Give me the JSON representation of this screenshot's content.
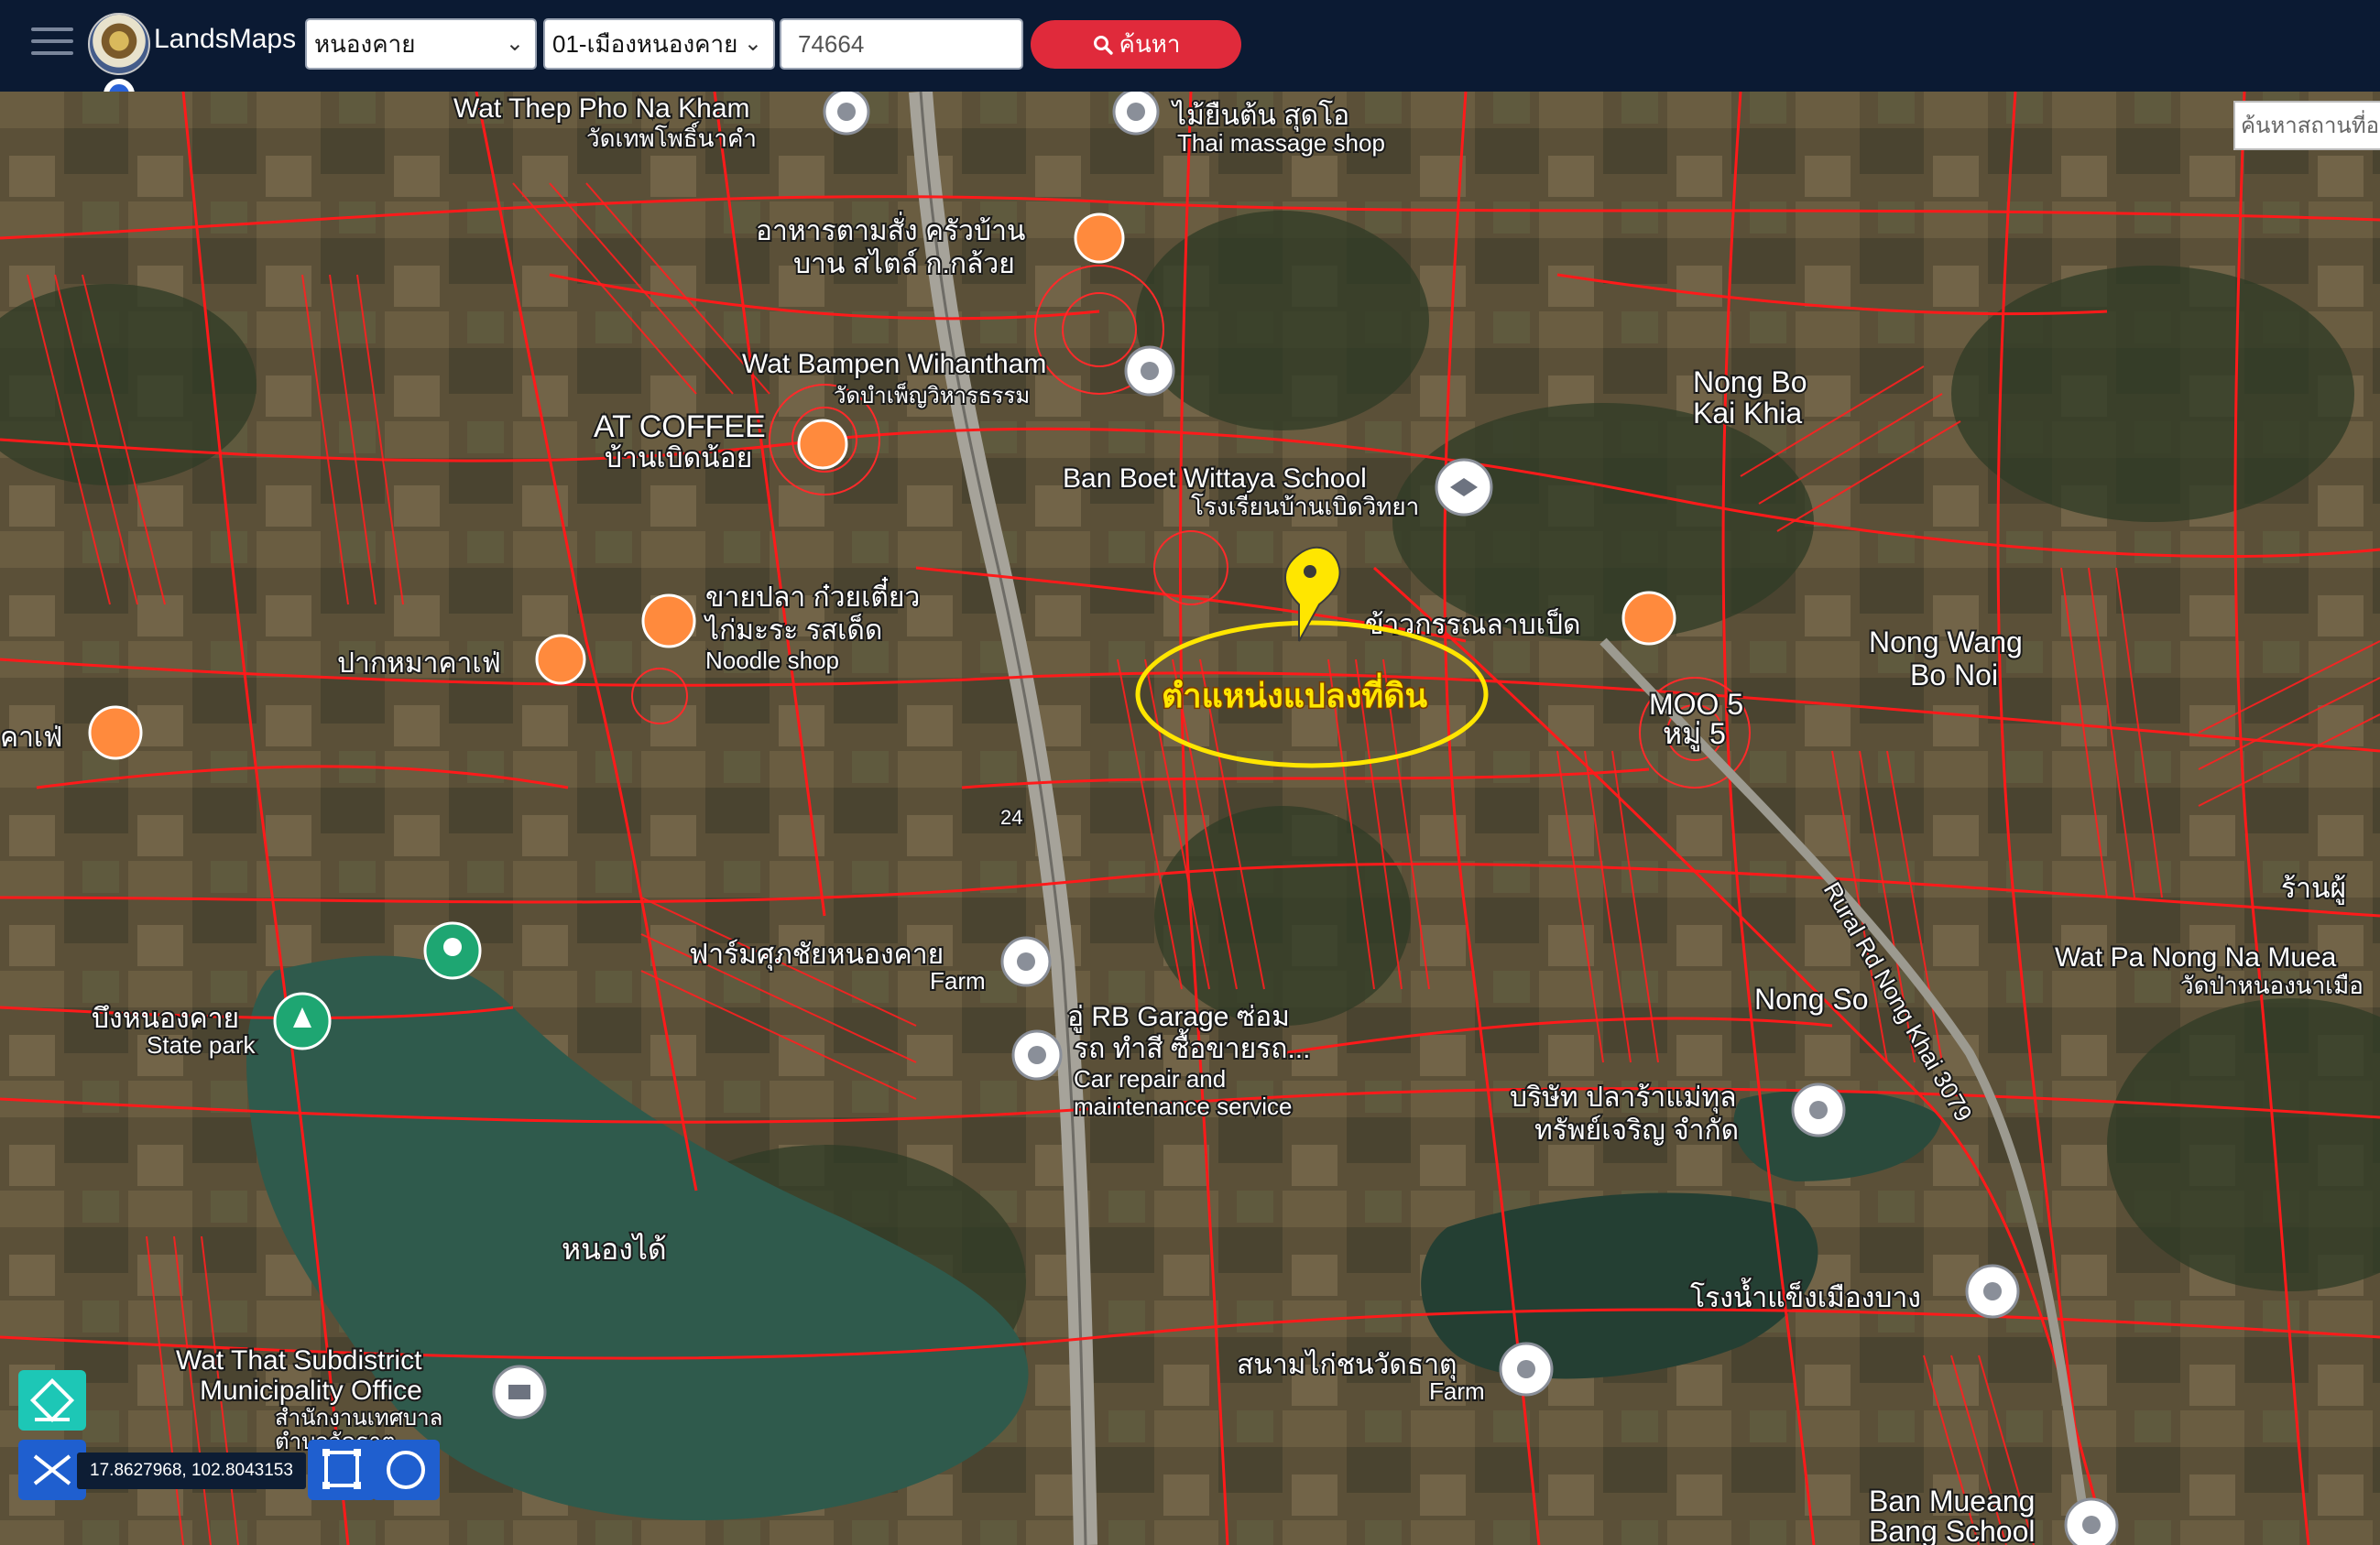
{
  "app": {
    "title": "LandsMaps"
  },
  "search": {
    "province": "หนองคาย",
    "district": "01-เมืองหนองคาย",
    "parcel_number": "74664",
    "button_label": "ค้นหา",
    "place_placeholder": "ค้นหาสถานที่อ"
  },
  "map": {
    "highlight_label": "ตำแหน่งแปลงที่ดิน",
    "labels": {
      "wat_thep": "Wat Thep Pho Na Kham",
      "wat_thep_th": "วัดเทพโพธิ์นาคำ",
      "mai_yuen": "ไม้ยืนต้น สุดโอ",
      "thai_massage": "Thai massage shop",
      "food_1": "อาหารตามสั่ง ครัวบ้าน",
      "food_2": "บาน สไตล์ ก.กล้วย",
      "wat_bampen": "Wat Bampen Wihantham",
      "wat_bampen_th": "วัดบำเพ็ญวิหารธรรม",
      "at_coffee": "AT COFFEE",
      "ban_boet": "บ้านเบิดน้อย",
      "school": "Ban Boet Wittaya School",
      "school_th": "โรงเรียนบ้านเบิดวิทยา",
      "nong_bo": "Nong Bo",
      "kai_khia": "Kai Khia",
      "noodle_th_1": "ขายปลา ก๋วยเตี๋ยว",
      "noodle_th_2": "ไก่มะระ รสเด็ด",
      "noodle_shop": "Noodle shop",
      "cafe_1": "ปากหมาคาเฟ่",
      "cafe_2": "คาเฟ่",
      "khaoduan": "ข้าวกรรณลาบเป็ด",
      "nong_wang": "Nong Wang",
      "bo_noi": "Bo Noi",
      "moo5": "MOO 5",
      "moo5_th": "หมู่ 5",
      "route": "24",
      "rural_rd": "Rural Rd Nong Khai 3079",
      "farm_th": "ฟาร์มศุภชัยหนองคาย",
      "farm": "Farm",
      "garage_1": "อู่ RB Garage ซ่อม",
      "garage_2": "รถ ทำสี ซื้อขายรถ...",
      "garage_3": "Car repair and",
      "garage_4": "maintenance service",
      "park_th": "บึงหนองคาย",
      "park": "State park",
      "nong_so": "Nong So",
      "company_1": "บริษัท ปลาร้าแม่ทุล",
      "company_2": "ทรัพย์เจริญ จำกัด",
      "wat_pa": "Wat Pa Nong Na Muea",
      "wat_pa_th": "วัดป่าหนองนาเมือ",
      "nong_dai": "หนองได้",
      "wat_that": "Wat That Subdistrict",
      "municipality": "Municipality Office",
      "municipality_th_1": "สำนักงานเทศบาล",
      "municipality_th_2": "ตำบลวัดธาตุ",
      "ice_factory": "โรงน้ำแข็งเมืองบาง",
      "cockfight": "สนามไก่ชนวัดธาตุ",
      "farm2": "Farm",
      "ban_mueang_1": "Ban Mueang",
      "ban_mueang_2": "Bang School",
      "sip_phu": "ร้านผู้"
    }
  },
  "toolbar": {
    "coordinates": "17.8627968, 102.8043153"
  },
  "icons": {
    "menu": "hamburger-icon",
    "logo": "department-seal",
    "search": "search-icon",
    "eraser": "eraser-icon",
    "measure": "measure-tool-icon",
    "rectangle": "rectangle-select-icon",
    "circle": "circle-select-icon",
    "pin": "map-pin-icon"
  },
  "colors": {
    "topbar": "#0b1a33",
    "parcel_lines": "#ff1a1a",
    "search_button": "#e02a3b",
    "highlight": "#ffe600",
    "tool": "#1f5fcf"
  }
}
